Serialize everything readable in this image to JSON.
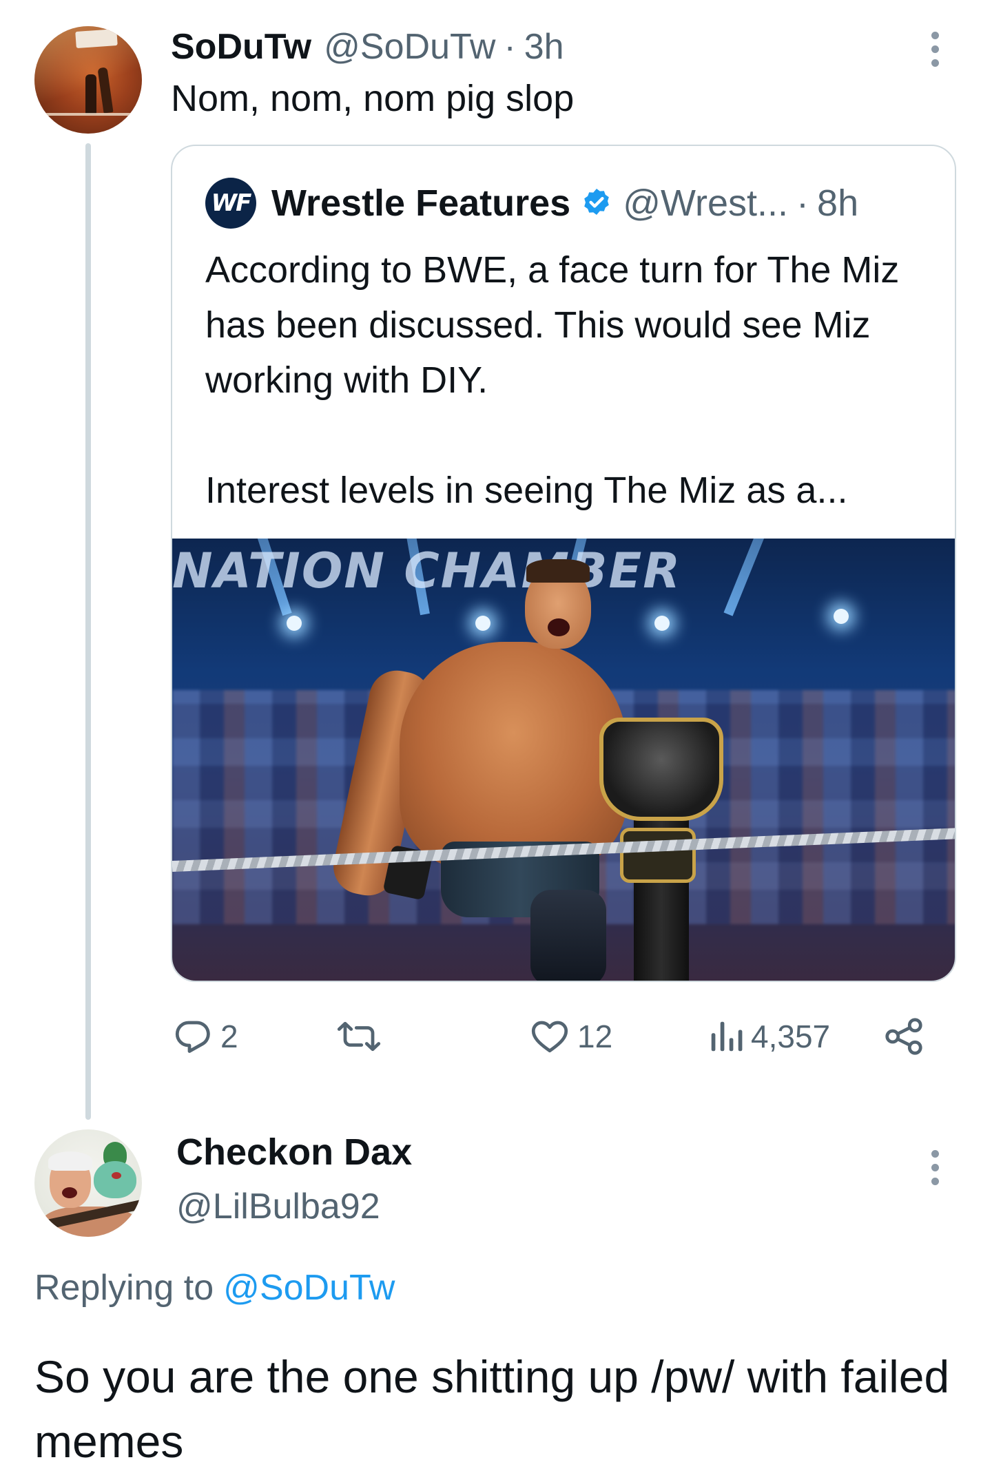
{
  "tweet1": {
    "display_name": "SoDuTw",
    "handle": "@SoDuTw",
    "separator": "·",
    "time": "3h",
    "text": "Nom, nom, nom pig slop",
    "avatar_icon": "avatar-wrestling-arena"
  },
  "quote": {
    "logo_text": "WF",
    "display_name": "Wrestle Features",
    "verified_icon": "verified-badge-icon",
    "handle": "@Wrest...",
    "separator": "·",
    "time": "8h",
    "body_line1": "According to BWE, a face turn for The Miz has been discussed. This would see Miz working with DIY.",
    "body_line2": "Interest levels in seeing The Miz as a...",
    "media_banner": "NATION CHAMBER"
  },
  "actions": {
    "reply_count": "2",
    "retweet_count": "",
    "like_count": "12",
    "views_count": "4,357"
  },
  "tweet2": {
    "display_name": "Checkon Dax",
    "handle": "@LilBulba92",
    "replying_prefix": "Replying to",
    "replying_mention": "@SoDuTw",
    "text": "So you are the one shitting up /pw/ with failed memes"
  },
  "colors": {
    "text_primary": "#0f1419",
    "text_secondary": "#536471",
    "link": "#1d9bf0",
    "border": "#cfd9de",
    "verified": "#1d9bf0"
  }
}
